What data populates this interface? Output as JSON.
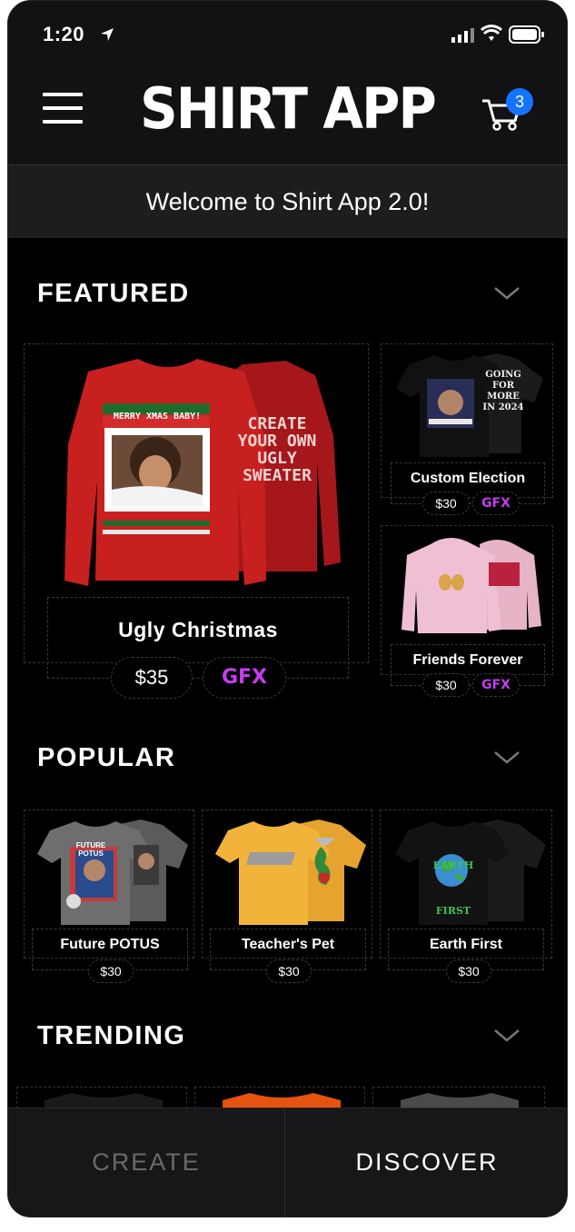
{
  "status": {
    "time": "1:20"
  },
  "header": {
    "title": "SHIRT APP",
    "cart_count": "3"
  },
  "welcome": "Welcome to Shirt App 2.0!",
  "sections": {
    "featured": "FEATURED",
    "popular": "POPULAR",
    "trending": "TRENDING"
  },
  "featured": {
    "main": {
      "name": "Ugly Christmas",
      "price": "$35",
      "gfx": "GFX",
      "front_text": "MERRY XMAS BABY!",
      "back_text": "CREATE YOUR OWN UGLY SWEATER"
    },
    "side": [
      {
        "name": "Custom Election",
        "price": "$30",
        "gfx": "GFX",
        "back_text": "GOING FOR MORE IN 2024"
      },
      {
        "name": "Friends Forever",
        "price": "$30",
        "gfx": "GFX"
      }
    ]
  },
  "popular": [
    {
      "name": "Future POTUS",
      "price": "$30",
      "shirt_text": "FUTURE POTUS"
    },
    {
      "name": "Teacher's Pet",
      "price": "$30"
    },
    {
      "name": "Earth First",
      "price": "$30",
      "shirt_text": "EARTH FIRST"
    }
  ],
  "nav": {
    "create": "CREATE",
    "discover": "DISCOVER"
  },
  "colors": {
    "badge": "#1673ff",
    "sweater": "#c8201f",
    "hoodie": "#efc0d3",
    "yellow_shirt": "#f2b33a"
  }
}
